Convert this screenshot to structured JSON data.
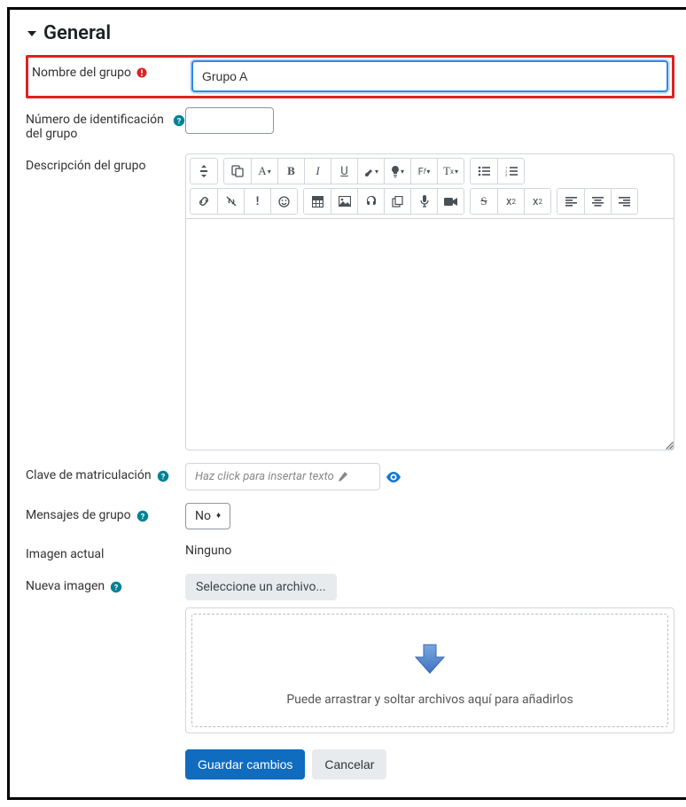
{
  "section": {
    "title": "General"
  },
  "fields": {
    "group_name": {
      "label": "Nombre del grupo",
      "value": "Grupo A"
    },
    "id_number": {
      "label": "Número de identificación del grupo",
      "value": ""
    },
    "description": {
      "label": "Descripción del grupo"
    },
    "enrol_key": {
      "label": "Clave de matriculación",
      "placeholder": "Haz click para insertar texto"
    },
    "group_messages": {
      "label": "Mensajes de grupo",
      "value": "No"
    },
    "current_image": {
      "label": "Imagen actual",
      "value": "Ninguno"
    },
    "new_image": {
      "label": "Nueva imagen",
      "button": "Seleccione un archivo...",
      "dropzone": "Puede arrastrar y soltar archivos aquí para añadirlos"
    }
  },
  "editor": {
    "row1": [
      "↕",
      "📄",
      "A▾",
      "B",
      "I",
      "U",
      "🖌▾",
      "💡▾",
      "F𝑓▾",
      "T𝑥▾",
      "•≡",
      "1≡"
    ],
    "row2": [
      "🔗",
      "⛓",
      "!",
      "☺",
      "⊞",
      "🖼",
      "🎧",
      "⧉",
      "🎤",
      "■",
      "S",
      "x₂",
      "x²",
      "≡",
      "≡",
      "≡"
    ]
  },
  "buttons": {
    "save": "Guardar cambios",
    "cancel": "Cancelar"
  }
}
